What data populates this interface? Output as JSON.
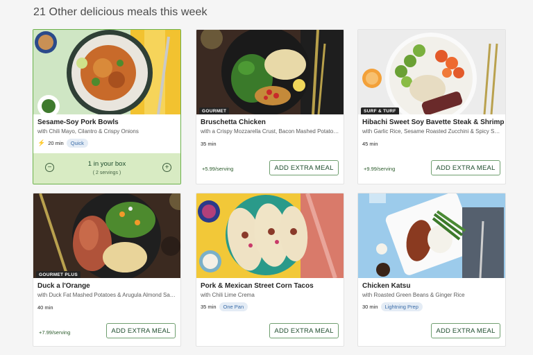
{
  "heading": "21 Other delicious meals this week",
  "cards": [
    {
      "title": "Sesame-Soy Pork Bowls",
      "subtitle": "with Chili Mayo, Cilantro & Crispy Onions",
      "time": "20 min",
      "pill": "Quick",
      "in_box": "1 in your box",
      "servings": "( 2 servings )",
      "minus": "−",
      "plus": "+"
    },
    {
      "tag": "GOURMET",
      "title": "Bruschetta Chicken",
      "subtitle": "with a Crispy Mozzarella Crust, Bacon Mashed Potatoes & Roasted Green Beans",
      "time": "35 min",
      "price": "+5.99/serving",
      "button": "ADD EXTRA MEAL"
    },
    {
      "tag": "SURF & TURF",
      "title": "Hibachi Sweet Soy Bavette Steak & Shrimp",
      "subtitle": "with Garlic Rice, Sesame Roasted Zucchini & Spicy Special Sauce",
      "time": "45 min",
      "price": "+9.99/serving",
      "button": "ADD EXTRA MEAL"
    },
    {
      "tag": "GOURMET PLUS",
      "title": "Duck a l'Orange",
      "subtitle": "with Duck Fat Mashed Potatoes & Arugula Almond Salad",
      "time": "40 min",
      "price": "+7.99/serving",
      "button": "ADD EXTRA MEAL"
    },
    {
      "title": "Pork & Mexican Street Corn Tacos",
      "subtitle": "with Chili Lime Crema",
      "time": "35 min",
      "pill": "One Pan",
      "button": "ADD EXTRA MEAL"
    },
    {
      "title": "Chicken Katsu",
      "subtitle": "with Roasted Green Beans & Ginger Rice",
      "time": "30 min",
      "pill": "Lightning Prep",
      "button": "ADD EXTRA MEAL"
    }
  ]
}
